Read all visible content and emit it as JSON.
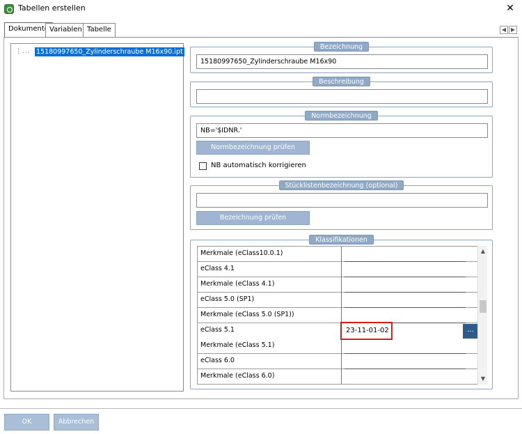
{
  "window": {
    "title": "Tabellen erstellen",
    "close_glyph": "✕"
  },
  "tabs": [
    {
      "label": "Dokumente",
      "active": true
    },
    {
      "label": "Variablen",
      "active": false
    },
    {
      "label": "Tabelle",
      "active": false
    }
  ],
  "tab_scroll": {
    "left": "◀",
    "right": "▶"
  },
  "documents": {
    "tree_prefix": "⋮...",
    "items": [
      "15180997650_Zylinderschraube M16x90.ipt"
    ]
  },
  "bezeichnung": {
    "legend": "Bezeichnung",
    "value": "15180997650_Zylinderschraube M16x90"
  },
  "beschreibung": {
    "legend": "Beschreibung",
    "value": ""
  },
  "normbezeichnung": {
    "legend": "Normbezeichnung",
    "value": "NB='$IDNR.'",
    "check_button": "Normbezeichnung prüfen",
    "auto_correct_label": "NB automatisch korrigieren",
    "auto_correct_checked": false
  },
  "stueckliste": {
    "legend": "Stücklistenbezeichnung (optional)",
    "value": "",
    "check_button": "Bezeichnung prüfen"
  },
  "klassifikationen": {
    "legend": "Klassifikationen",
    "rows": [
      {
        "name": "Merkmale (eClass10.0.1)",
        "value": ""
      },
      {
        "name": "eClass 4.1",
        "value": ""
      },
      {
        "name": "Merkmale (eClass 4.1)",
        "value": ""
      },
      {
        "name": "eClass 5.0 (SP1)",
        "value": ""
      },
      {
        "name": "Merkmale (eClass 5.0 (SP1))",
        "value": ""
      },
      {
        "name": "eClass 5.1",
        "value": "23-11-01-02"
      },
      {
        "name": "Merkmale (eClass 5.1)",
        "value": ""
      },
      {
        "name": "eClass 6.0",
        "value": ""
      },
      {
        "name": "Merkmale (eClass 6.0)",
        "value": ""
      }
    ],
    "browse_label": "...",
    "scroll_up": "▲",
    "scroll_down": "▼"
  },
  "footer": {
    "ok": "OK",
    "cancel": "Abbrechen"
  },
  "colors": {
    "highlight": "#e01919",
    "selection": "#0b6fd4",
    "legend_bg": "#8fa9c7",
    "button_bg": "#9fb5d2"
  }
}
